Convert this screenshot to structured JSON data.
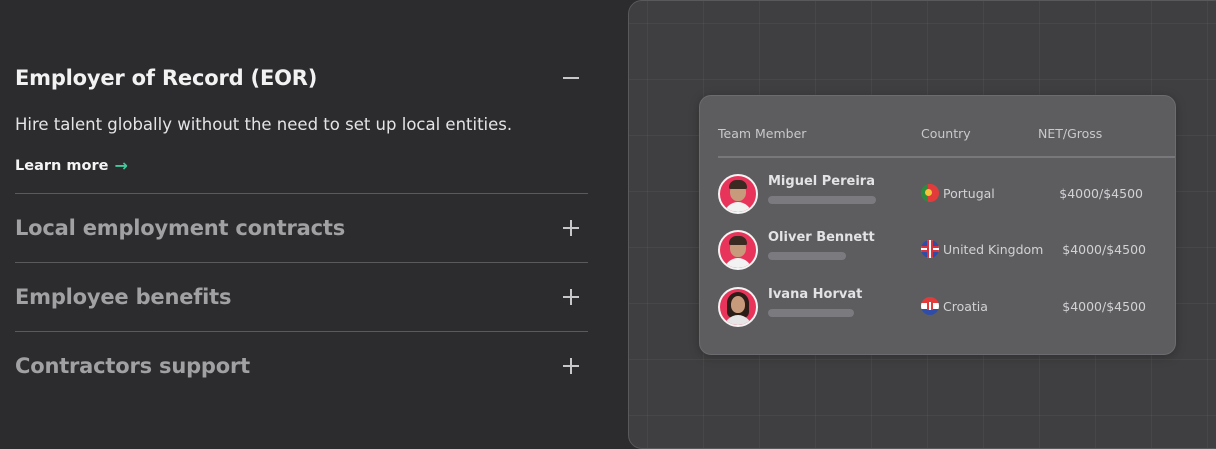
{
  "accordion": {
    "items": [
      {
        "title": "Employer of Record (EOR)",
        "description": "Hire talent globally without the need to set up local entities.",
        "link_label": "Learn more",
        "expanded": true
      },
      {
        "title": "Local employment contracts",
        "expanded": false
      },
      {
        "title": "Employee benefits",
        "expanded": false
      },
      {
        "title": "Contractors support",
        "expanded": false
      }
    ]
  },
  "table": {
    "headers": {
      "member": "Team Member",
      "country": "Country",
      "pay": "NET/Gross"
    },
    "rows": [
      {
        "name": "Miguel Pereira",
        "country": "Portugal",
        "flag": "portugal-flag-icon",
        "amount": "$4000/$4500"
      },
      {
        "name": "Oliver Bennett",
        "country": "United Kingdom",
        "flag": "uk-flag-icon",
        "amount": "$4000/$4500"
      },
      {
        "name": "Ivana Horvat",
        "country": "Croatia",
        "flag": "croatia-flag-icon",
        "amount": "$4000/$4500"
      }
    ]
  },
  "colors": {
    "background": "#2c2c2e",
    "accent": "#42c99a",
    "avatar_bg": "#e8345a",
    "card": "#5d5d60"
  }
}
